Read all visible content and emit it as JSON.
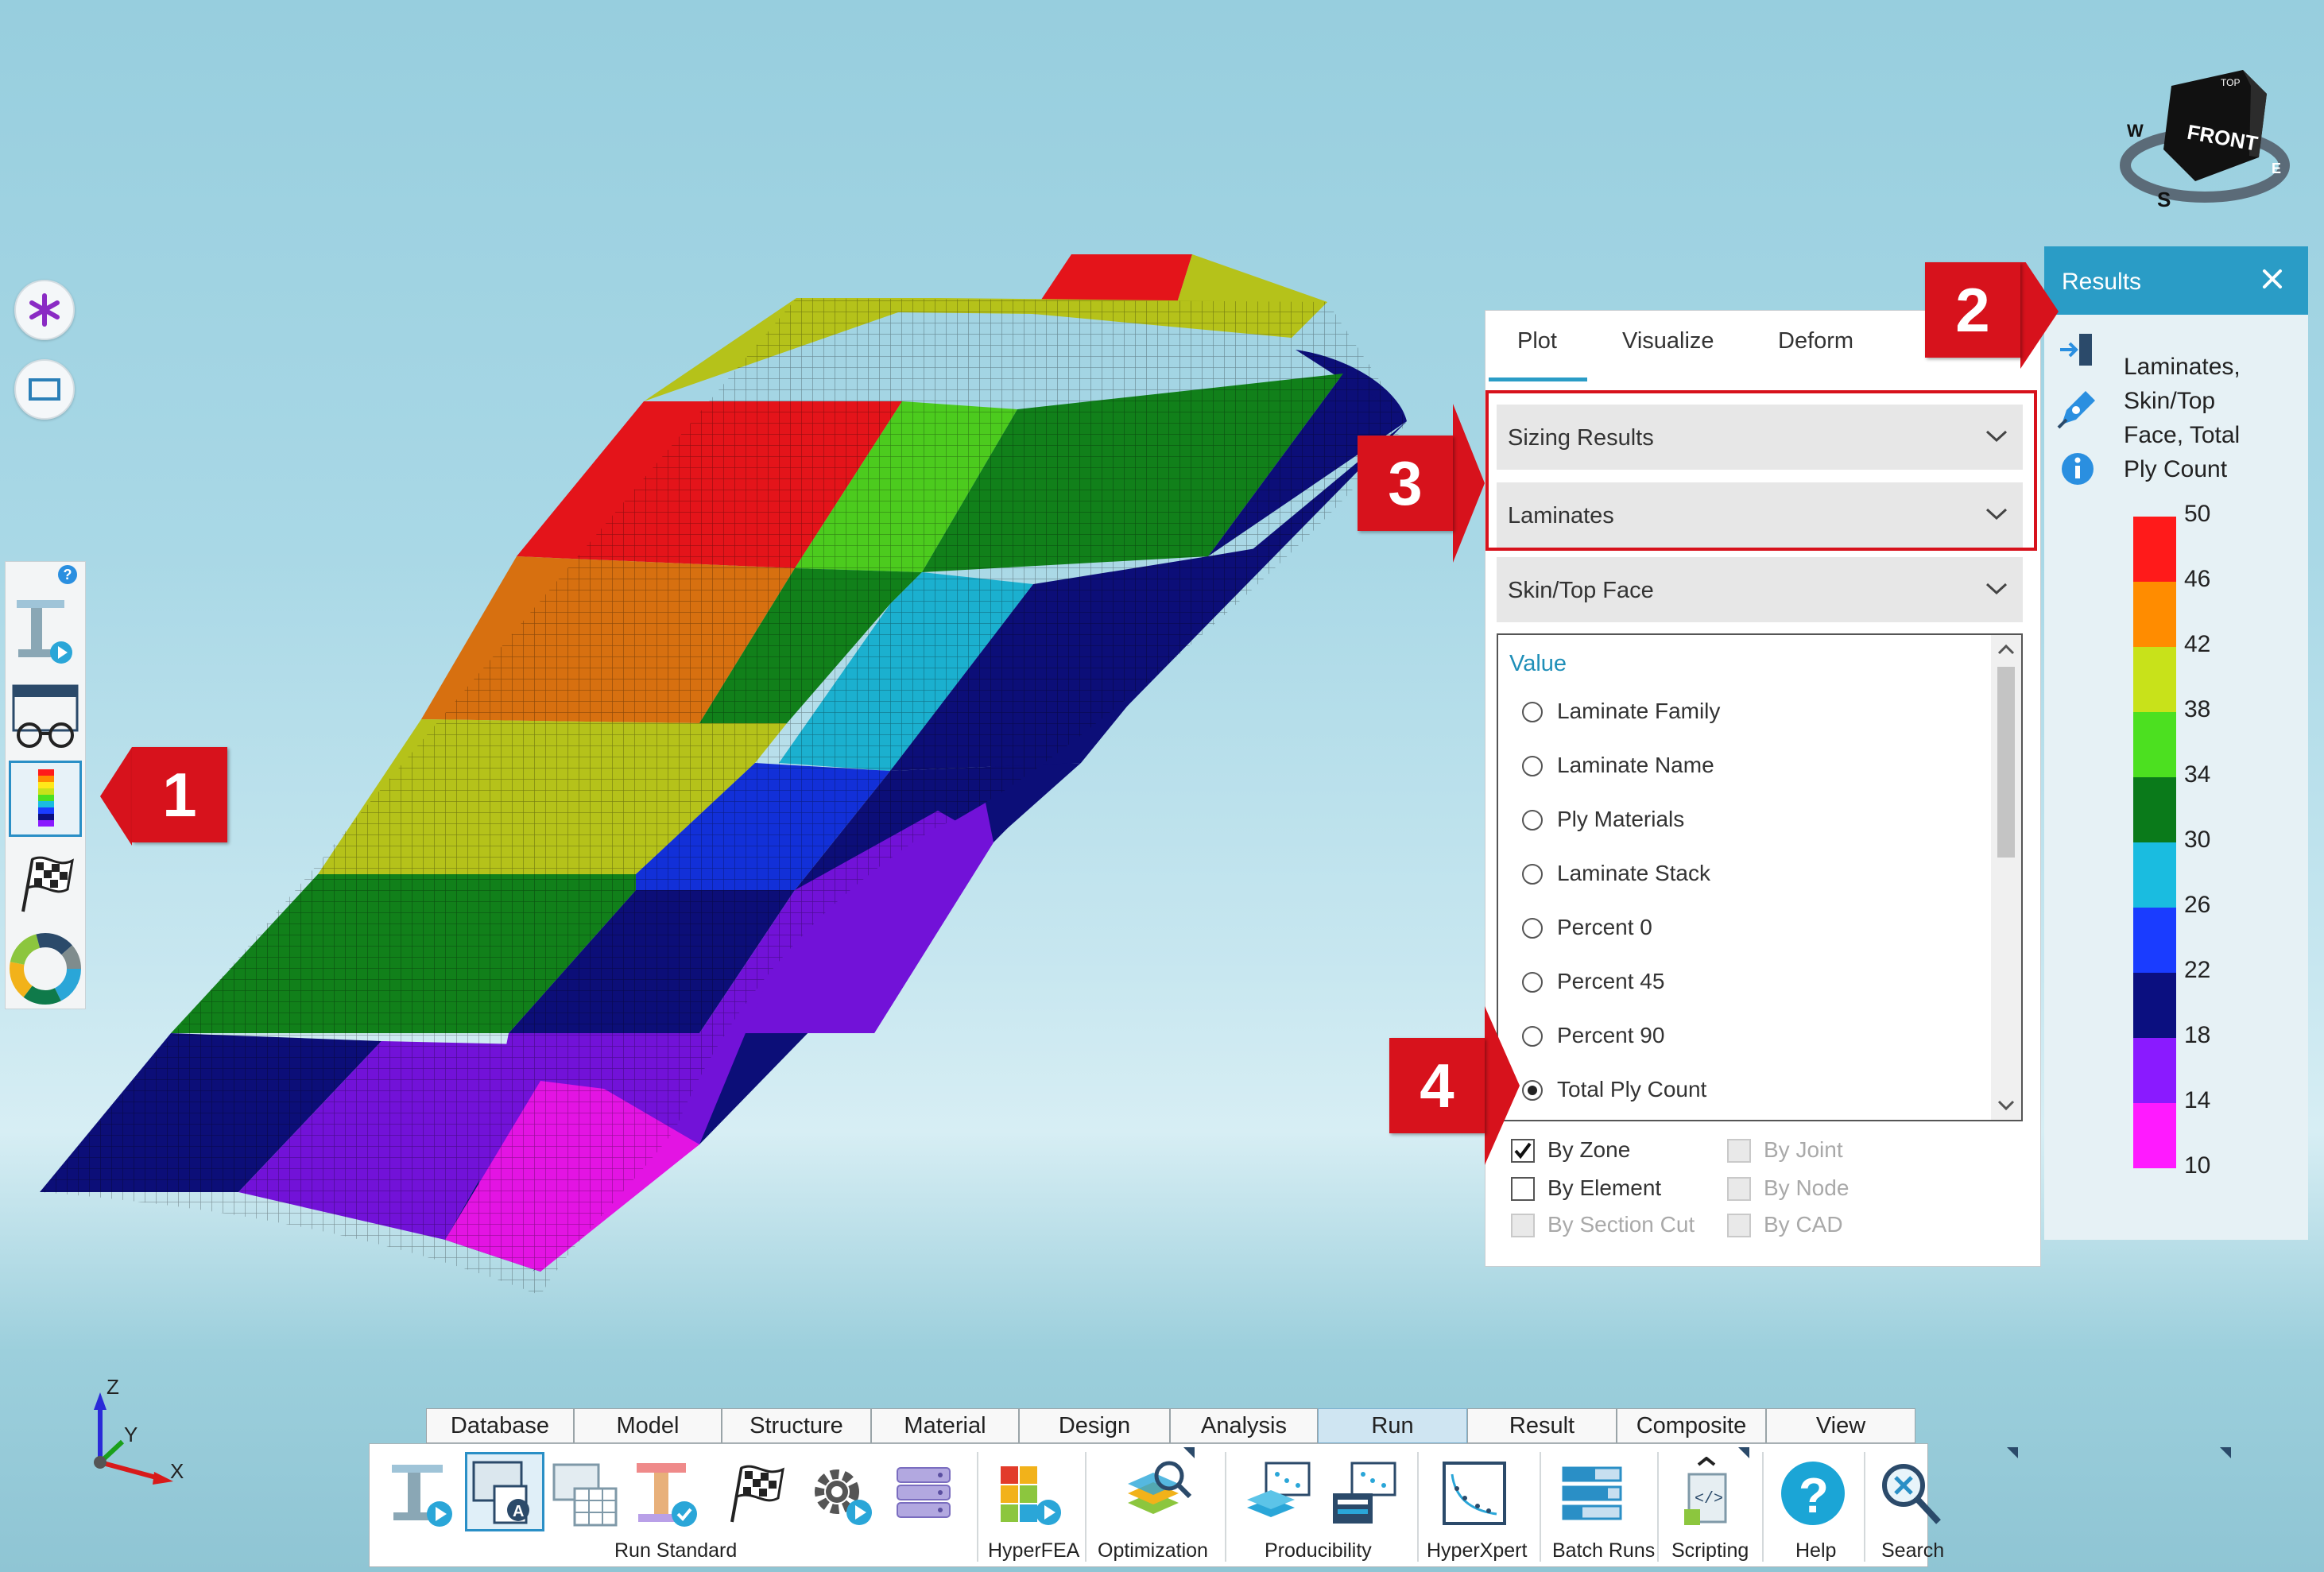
{
  "left_toolbar": {
    "help_badge": "?",
    "tools": [
      "asterisk-icon",
      "rectangle-select-icon",
      "run-icon",
      "glasses-icon",
      "results-contour-icon",
      "checkered-flag-icon",
      "color-wheel-icon"
    ]
  },
  "view_cube": {
    "face": "FRONT",
    "top": "TOP",
    "compass": [
      "W",
      "S",
      "E"
    ]
  },
  "panel": {
    "tabs": [
      "Plot",
      "Visualize",
      "Deform"
    ],
    "active_tab": "Plot",
    "dropdowns": [
      "Sizing Results",
      "Laminates",
      "Skin/Top Face"
    ],
    "list_header": "Value",
    "options": [
      "Laminate Family",
      "Laminate Name",
      "Ply Materials",
      "Laminate Stack",
      "Percent 0",
      "Percent 45",
      "Percent 90",
      "Total Ply Count"
    ],
    "selected_option": "Total Ply Count",
    "checkboxes": [
      {
        "label": "By Zone",
        "checked": true,
        "enabled": true
      },
      {
        "label": "By Joint",
        "checked": false,
        "enabled": false
      },
      {
        "label": "By Element",
        "checked": false,
        "enabled": true
      },
      {
        "label": "By Node",
        "checked": false,
        "enabled": false
      },
      {
        "label": "By Section Cut",
        "checked": false,
        "enabled": false
      },
      {
        "label": "By CAD",
        "checked": false,
        "enabled": false
      }
    ]
  },
  "results": {
    "title": "Results",
    "description_lines": [
      "Laminates,",
      "Skin/Top",
      "Face, Total",
      "Ply Count"
    ],
    "legend": {
      "values": [
        "50",
        "46",
        "42",
        "38",
        "34",
        "30",
        "26",
        "22",
        "18",
        "14",
        "10"
      ],
      "colors": [
        "#ff1a1a",
        "#ff8c00",
        "#c8e21a",
        "#4ce020",
        "#0a7a1a",
        "#1abce0",
        "#1a3cff",
        "#0b0f80",
        "#8a1aff",
        "#ff1aff"
      ]
    }
  },
  "callouts": [
    "1",
    "2",
    "3",
    "4"
  ],
  "axes": {
    "z": "Z",
    "y": "Y",
    "x": "X"
  },
  "ribbon": {
    "tabs": [
      "Database",
      "Model",
      "Structure",
      "Material",
      "Design",
      "Analysis",
      "Run",
      "Result",
      "Composite",
      "View"
    ],
    "active_tab": "Run",
    "groups": [
      "Run Standard",
      "HyperFEA",
      "Optimization",
      "Producibility",
      "HyperXpert",
      "Batch Runs",
      "Scripting",
      "Help",
      "Search"
    ]
  },
  "wing_colors": {
    "red": "#e4141a",
    "orange": "#d77010",
    "yellow": "#b5c21a",
    "green_light": "#4ccb1e",
    "green_dark": "#11801a",
    "cyan": "#1bb0cf",
    "blue": "#1230d8",
    "navy": "#0c0e78",
    "purple": "#7212d8",
    "magenta": "#e314e3"
  }
}
